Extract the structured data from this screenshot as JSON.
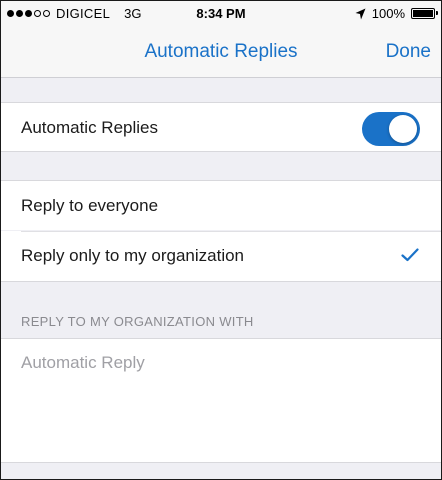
{
  "status_bar": {
    "carrier": "DIGICEL",
    "network": "3G",
    "time": "8:34 PM",
    "battery": "100%",
    "signal_dots_filled": 3,
    "signal_dots_total": 5
  },
  "nav": {
    "title": "Automatic Replies",
    "done_label": "Done"
  },
  "toggle_row": {
    "label": "Automatic Replies",
    "enabled": true
  },
  "reply_options": [
    {
      "label": "Reply to everyone",
      "selected": false
    },
    {
      "label": "Reply only to my organization",
      "selected": true
    }
  ],
  "org_section": {
    "header": "REPLY TO MY ORGANIZATION WITH",
    "message_placeholder": "Automatic Reply"
  },
  "colors": {
    "accent": "#1a72c8",
    "background": "#efeff4"
  }
}
